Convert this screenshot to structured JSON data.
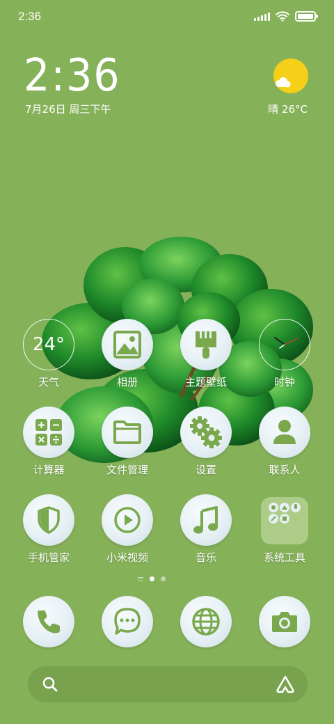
{
  "status_bar": {
    "time": "2:36",
    "battery_level": 1.0
  },
  "clock_widget": {
    "time": "2:36",
    "date": "7月26日 周三下午"
  },
  "weather_widget": {
    "text": "晴 26°C",
    "icon": "sunny-cloud-icon"
  },
  "apps": [
    {
      "name": "weather",
      "label": "天气",
      "icon": "weather-temp-widget",
      "value": "24°"
    },
    {
      "name": "gallery",
      "label": "相册",
      "icon": "picture-icon"
    },
    {
      "name": "themes",
      "label": "主题壁纸",
      "icon": "brush-icon"
    },
    {
      "name": "clock",
      "label": "时钟",
      "icon": "clock-icon"
    },
    {
      "name": "calculator",
      "label": "计算器",
      "icon": "calculator-icon"
    },
    {
      "name": "file-manager",
      "label": "文件管理",
      "icon": "folder-icon"
    },
    {
      "name": "settings",
      "label": "设置",
      "icon": "gears-icon"
    },
    {
      "name": "contacts",
      "label": "联系人",
      "icon": "person-icon"
    },
    {
      "name": "security",
      "label": "手机管家",
      "icon": "shield-icon"
    },
    {
      "name": "mi-video",
      "label": "小米视频",
      "icon": "play-icon"
    },
    {
      "name": "music",
      "label": "音乐",
      "icon": "music-note-icon"
    },
    {
      "name": "system-tools",
      "label": "系统工具",
      "icon": "folder-group-icon"
    }
  ],
  "page_indicator": {
    "current": 1,
    "pages": 2
  },
  "dock": [
    {
      "name": "phone",
      "icon": "phone-icon"
    },
    {
      "name": "messages",
      "icon": "message-icon"
    },
    {
      "name": "browser",
      "icon": "globe-icon"
    },
    {
      "name": "camera",
      "icon": "camera-icon"
    }
  ],
  "search_bar": {
    "placeholder": ""
  },
  "colors": {
    "background": "#85b158",
    "icon_glyph": "#7aa84d",
    "icon_bg": "#e6f0f4"
  }
}
